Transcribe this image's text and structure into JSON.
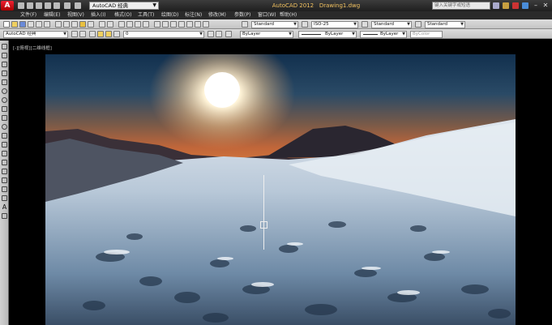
{
  "titlebar": {
    "workspace": "AutoCAD 经典",
    "app_name": "AutoCAD 2012",
    "document": "Drawing1.dwg",
    "search_placeholder": "键入关键字或短语"
  },
  "menu": [
    "文件(F)",
    "编辑(E)",
    "视图(V)",
    "插入(I)",
    "格式(O)",
    "工具(T)",
    "绘图(D)",
    "标注(N)",
    "修改(M)",
    "参数(P)",
    "窗口(W)",
    "帮助(H)"
  ],
  "toolbar1": {
    "text_style": "Standard",
    "dim_style": "ISO-25",
    "table_style": "Standard",
    "mleader_style": "Standard"
  },
  "toolbar2": {
    "workspace": "AutoCAD 经典",
    "layer": "0",
    "color": "ByLayer",
    "linetype": "ByLayer",
    "lineweight": "ByLayer",
    "plotstyle": "ByColor"
  },
  "viewport": {
    "label": "[-][俯视][二维线框]"
  },
  "colors": {
    "accent": "#f0c060",
    "background": "#000000"
  }
}
